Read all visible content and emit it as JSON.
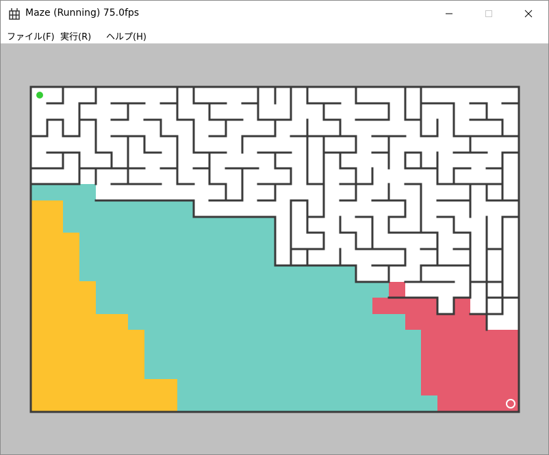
{
  "window": {
    "title": "Maze (Running) 75.0fps"
  },
  "menu": {
    "items": [
      {
        "label": "ファイル(F)"
      },
      {
        "label": "実行(R)"
      },
      {
        "label": "ヘルプ(H)"
      }
    ]
  },
  "colors": {
    "client_bg": "#c0c0c0",
    "maze_bg": "#ffffff",
    "wall": "#3a3a3a",
    "region_yellow": "#fdc22e",
    "region_teal": "#72cfc2",
    "region_red": "#e65b6e",
    "start_marker": "#35cc35",
    "goal_marker": "#ffffff"
  },
  "icons": {
    "app": "maze-app-icon",
    "minimize": "minimize-icon",
    "maximize": "maximize-icon",
    "close": "close-icon"
  }
}
